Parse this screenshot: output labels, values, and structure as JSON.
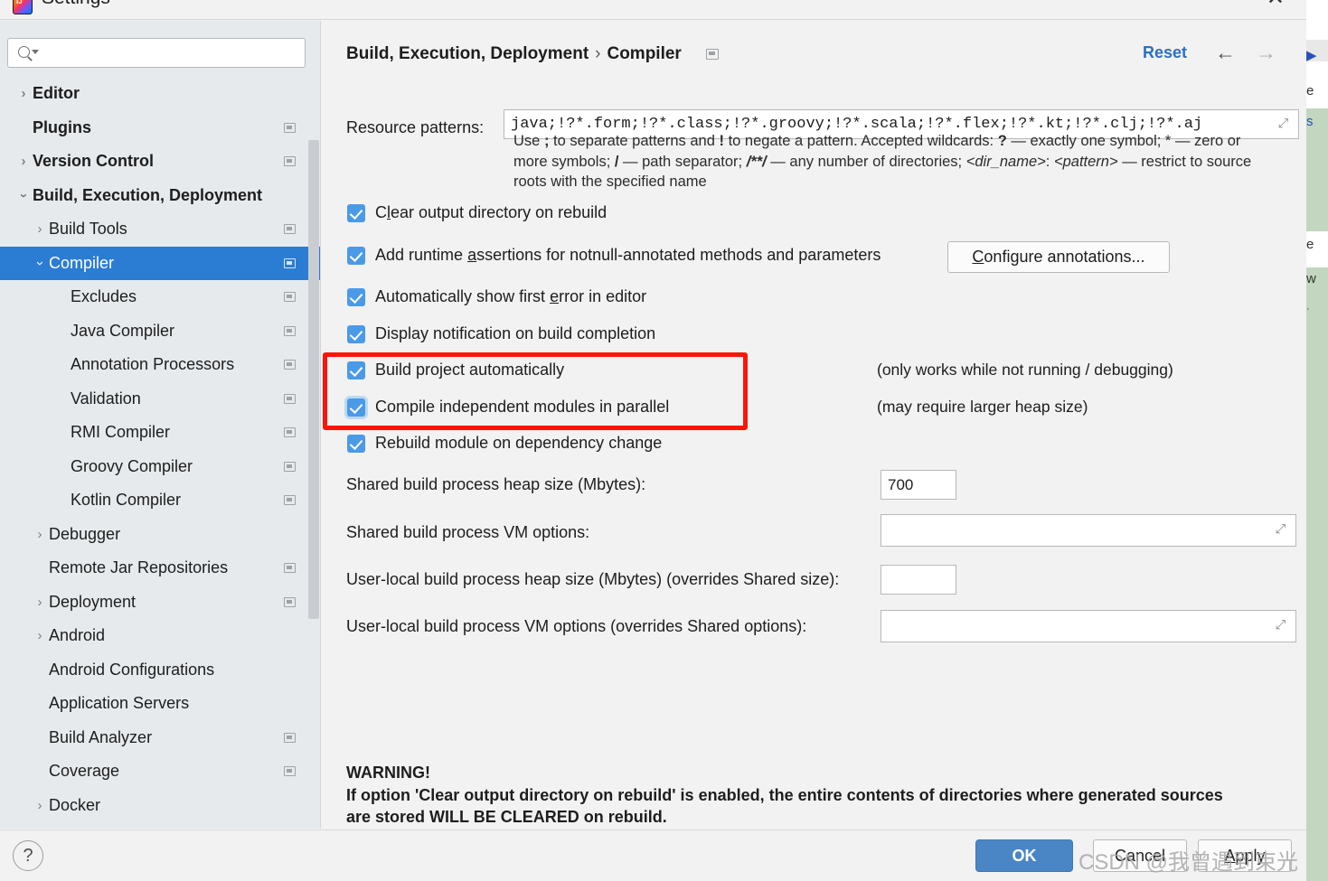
{
  "window": {
    "title": "Settings",
    "close_label": "✕",
    "app_icon": "intellij-idea-icon"
  },
  "sidebar": {
    "search": {
      "value": "",
      "placeholder": ""
    },
    "items": [
      {
        "label": "Editor",
        "indent": 0,
        "twisty": "right",
        "bold": true,
        "badge": false,
        "selected": false
      },
      {
        "label": "Plugins",
        "indent": 0,
        "twisty": "none",
        "bold": true,
        "badge": true,
        "selected": false
      },
      {
        "label": "Version Control",
        "indent": 0,
        "twisty": "right",
        "bold": true,
        "badge": true,
        "selected": false
      },
      {
        "label": "Build, Execution, Deployment",
        "indent": 0,
        "twisty": "down",
        "bold": true,
        "badge": false,
        "selected": false
      },
      {
        "label": "Build Tools",
        "indent": 1,
        "twisty": "right",
        "bold": false,
        "badge": true,
        "selected": false
      },
      {
        "label": "Compiler",
        "indent": 1,
        "twisty": "down",
        "bold": false,
        "badge": true,
        "selected": true
      },
      {
        "label": "Excludes",
        "indent": 2,
        "twisty": "none",
        "bold": false,
        "badge": true,
        "selected": false
      },
      {
        "label": "Java Compiler",
        "indent": 2,
        "twisty": "none",
        "bold": false,
        "badge": true,
        "selected": false
      },
      {
        "label": "Annotation Processors",
        "indent": 2,
        "twisty": "none",
        "bold": false,
        "badge": true,
        "selected": false
      },
      {
        "label": "Validation",
        "indent": 2,
        "twisty": "none",
        "bold": false,
        "badge": true,
        "selected": false
      },
      {
        "label": "RMI Compiler",
        "indent": 2,
        "twisty": "none",
        "bold": false,
        "badge": true,
        "selected": false
      },
      {
        "label": "Groovy Compiler",
        "indent": 2,
        "twisty": "none",
        "bold": false,
        "badge": true,
        "selected": false
      },
      {
        "label": "Kotlin Compiler",
        "indent": 2,
        "twisty": "none",
        "bold": false,
        "badge": true,
        "selected": false
      },
      {
        "label": "Debugger",
        "indent": 1,
        "twisty": "right",
        "bold": false,
        "badge": false,
        "selected": false
      },
      {
        "label": "Remote Jar Repositories",
        "indent": 1,
        "twisty": "none",
        "bold": false,
        "badge": true,
        "selected": false
      },
      {
        "label": "Deployment",
        "indent": 1,
        "twisty": "right",
        "bold": false,
        "badge": true,
        "selected": false
      },
      {
        "label": "Android",
        "indent": 1,
        "twisty": "right",
        "bold": false,
        "badge": false,
        "selected": false
      },
      {
        "label": "Android Configurations",
        "indent": 1,
        "twisty": "none",
        "bold": false,
        "badge": false,
        "selected": false
      },
      {
        "label": "Application Servers",
        "indent": 1,
        "twisty": "none",
        "bold": false,
        "badge": false,
        "selected": false
      },
      {
        "label": "Build Analyzer",
        "indent": 1,
        "twisty": "none",
        "bold": false,
        "badge": true,
        "selected": false
      },
      {
        "label": "Coverage",
        "indent": 1,
        "twisty": "none",
        "bold": false,
        "badge": true,
        "selected": false
      },
      {
        "label": "Docker",
        "indent": 1,
        "twisty": "right",
        "bold": false,
        "badge": false,
        "selected": false
      }
    ]
  },
  "header": {
    "breadcrumb_parent": "Build, Execution, Deployment",
    "breadcrumb_sep": "›",
    "breadcrumb_current": "Compiler",
    "reset_label": "Reset",
    "back_arrow": "←",
    "forward_arrow": "→"
  },
  "main": {
    "resource_patterns": {
      "label": "Resource patterns:",
      "value": "java;!?*.form;!?*.class;!?*.groovy;!?*.scala;!?*.flex;!?*.kt;!?*.clj;!?*.aj",
      "expand_icon": "⤢"
    },
    "hint": {
      "part1": "Use ",
      "semi": ";",
      "part2": " to separate patterns and ",
      "bang": "!",
      "part3": " to negate a pattern. Accepted wildcards: ",
      "q": "?",
      "part4": " — exactly one symbol; * — zero or more symbols; ",
      "slash": "/",
      "part5": " — path separator; ",
      "globstar": "/**/",
      "part6": " — any number of directories;  ",
      "dirname": "<dir_name>",
      "colon": ": ",
      "pattern": "<pattern>",
      "part7": " — restrict to source roots with the specified name"
    },
    "checkboxes": [
      {
        "label": "Clear output directory on rebuild",
        "checked": true,
        "focused": false,
        "mnemonic": "l"
      },
      {
        "label": "Add runtime assertions for notnull-annotated methods and parameters",
        "checked": true,
        "focused": false,
        "mnemonic": "a"
      },
      {
        "label": "Automatically show first error in editor",
        "checked": true,
        "focused": false,
        "mnemonic": "e"
      },
      {
        "label": "Display notification on build completion",
        "checked": true,
        "focused": false,
        "mnemonic": ""
      },
      {
        "label": "Build project automatically",
        "checked": true,
        "focused": false,
        "mnemonic": ""
      },
      {
        "label": "Compile independent modules in parallel",
        "checked": true,
        "focused": true,
        "mnemonic": ""
      },
      {
        "label": "Rebuild module on dependency change",
        "checked": true,
        "focused": false,
        "mnemonic": ""
      }
    ],
    "configure_annotations_label": "Configure annotations...",
    "note_auto_build": "(only works while not running / debugging)",
    "note_parallel": "(may require larger heap size)",
    "fields": [
      {
        "label": "Shared build process heap size (Mbytes):",
        "value": "700",
        "wide": false,
        "expandable": false
      },
      {
        "label": "Shared build process VM options:",
        "value": "",
        "wide": true,
        "expandable": true
      },
      {
        "label": "User-local build process heap size (Mbytes) (overrides Shared size):",
        "value": "",
        "wide": false,
        "expandable": false
      },
      {
        "label": "User-local build process VM options (overrides Shared options):",
        "value": "",
        "wide": true,
        "expandable": true
      }
    ],
    "warning": {
      "heading": "WARNING!",
      "line1": "If option 'Clear output directory on rebuild' is enabled, the entire contents of directories where generated sources",
      "line2": "are stored WILL BE CLEARED on rebuild."
    }
  },
  "footer": {
    "help_label": "?",
    "ok_label": "OK",
    "cancel_label": "Cancel",
    "apply_label": "Apply",
    "apply_mnemonic": "A"
  },
  "overlay": {
    "watermark": "CSDN @我曾遇到束光",
    "highlight_color": "#fc1505"
  },
  "background": {
    "fragments": [
      "▶",
      "e",
      "s",
      "e",
      "w",
      "·"
    ]
  }
}
